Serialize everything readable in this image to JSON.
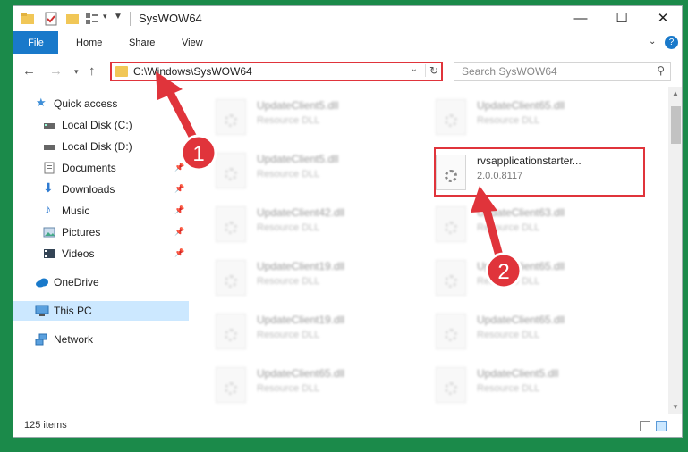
{
  "window": {
    "title": "SysWOW64"
  },
  "ribbon": {
    "tabs": [
      "File",
      "Home",
      "Share",
      "View"
    ]
  },
  "address": {
    "path": "C:\\Windows\\SysWOW64"
  },
  "search": {
    "placeholder": "Search SysWOW64"
  },
  "sidebar": {
    "items": [
      {
        "label": "Quick access",
        "icon": "star-icon"
      },
      {
        "label": "Local Disk (C:)",
        "icon": "drive-icon"
      },
      {
        "label": "Local Disk (D:)",
        "icon": "drive-icon"
      },
      {
        "label": "Documents",
        "icon": "documents-icon"
      },
      {
        "label": "Downloads",
        "icon": "download-icon"
      },
      {
        "label": "Music",
        "icon": "music-icon"
      },
      {
        "label": "Pictures",
        "icon": "pictures-icon"
      },
      {
        "label": "Videos",
        "icon": "videos-icon"
      },
      {
        "label": "OneDrive",
        "icon": "cloud-icon"
      },
      {
        "label": "This PC",
        "icon": "computer-icon"
      },
      {
        "label": "Network",
        "icon": "network-icon"
      }
    ]
  },
  "files": {
    "col1": [
      {
        "name": "UpdateClient5.dll",
        "sub": "Resource DLL"
      },
      {
        "name": "UpdateClient5.dll",
        "sub": "Resource DLL"
      },
      {
        "name": "UpdateClient42.dll",
        "sub": "Resource DLL"
      },
      {
        "name": "UpdateClient19.dll",
        "sub": "Resource DLL"
      },
      {
        "name": "UpdateClient19.dll",
        "sub": "Resource DLL"
      },
      {
        "name": "UpdateClient65.dll",
        "sub": "Resource DLL"
      }
    ],
    "col2": [
      {
        "name": "UpdateClient65.dll",
        "sub": "Resource DLL"
      },
      {
        "name": "rvsapplicationstarter...",
        "sub": "2.0.0.8117"
      },
      {
        "name": "UpdateClient63.dll",
        "sub": "Resource DLL"
      },
      {
        "name": "UpdateClient65.dll",
        "sub": "Resource DLL"
      },
      {
        "name": "UpdateClient65.dll",
        "sub": "Resource DLL"
      },
      {
        "name": "UpdateClient5.dll",
        "sub": "Resource DLL"
      }
    ]
  },
  "status": {
    "count": "125 items"
  },
  "annotations": {
    "step1": "1",
    "step2": "2"
  },
  "colors": {
    "accent": "#1979ca",
    "highlight": "#e0343b",
    "background": "#1b8a4a"
  }
}
